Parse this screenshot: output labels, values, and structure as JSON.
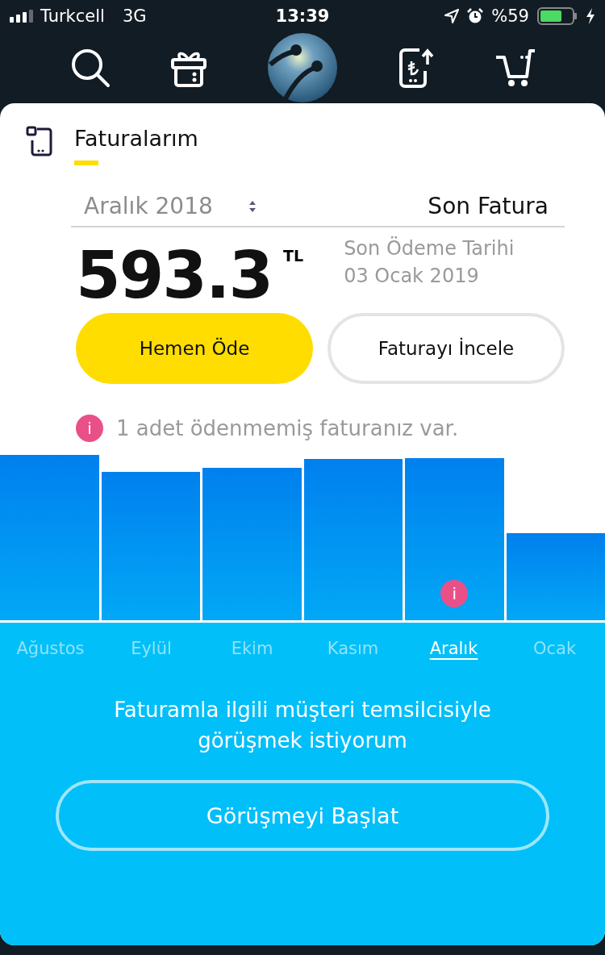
{
  "status_bar": {
    "carrier": "Turkcell",
    "network": "3G",
    "time": "13:39",
    "battery": "%59"
  },
  "page": {
    "title": "Faturalarım"
  },
  "bill_picker": {
    "period": "Aralık 2018",
    "type": "Son Fatura"
  },
  "bill": {
    "amount": "593.3",
    "currency": "TL",
    "due_label": "Son Ödeme Tarihi",
    "due_date": "03 Ocak 2019"
  },
  "buttons": {
    "pay": "Hemen Öde",
    "review": "Faturayı İncele"
  },
  "notice": {
    "icon": "i",
    "text": "1 adet ödenmemiş faturanız var."
  },
  "months": [
    {
      "label": "Ağustos",
      "selected": false,
      "unpaid": false
    },
    {
      "label": "Eylül",
      "selected": false,
      "unpaid": false
    },
    {
      "label": "Ekim",
      "selected": false,
      "unpaid": false
    },
    {
      "label": "Kasım",
      "selected": false,
      "unpaid": false
    },
    {
      "label": "Aralık",
      "selected": true,
      "unpaid": true,
      "mark": "i"
    },
    {
      "label": "Ocak",
      "selected": false,
      "unpaid": false
    }
  ],
  "support": {
    "text": "Faturamla ilgili müşteri temsilcisiyle görüşmek istiyorum",
    "button": "Görüşmeyi Başlat"
  }
}
